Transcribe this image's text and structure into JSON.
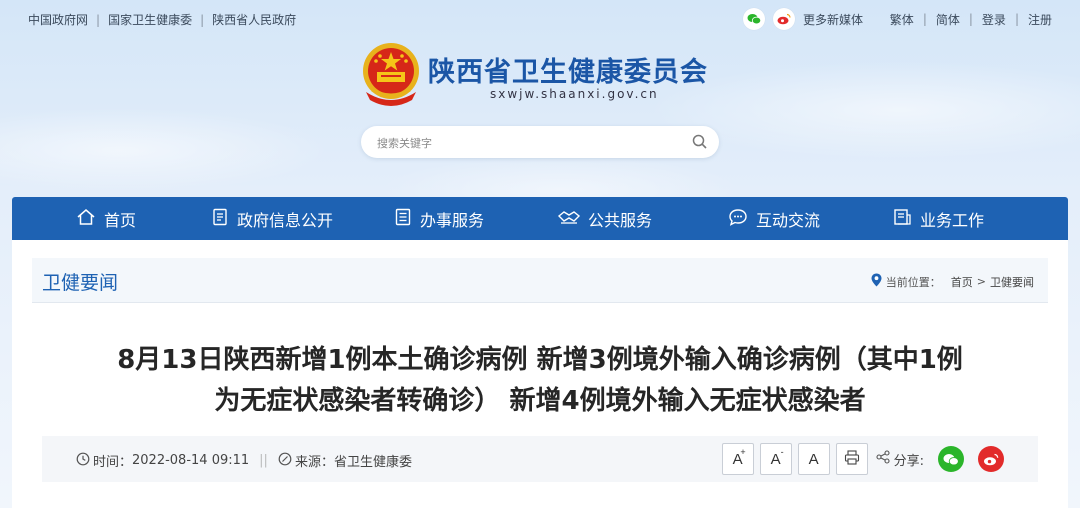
{
  "top_links": [
    "中国政府网",
    "国家卫生健康委",
    "陕西省人民政府"
  ],
  "top_right": {
    "media": "更多新媒体",
    "traditional": "繁体",
    "simplified": "简体",
    "login": "登录",
    "register": "注册"
  },
  "site": {
    "title": "陕西省卫生健康委员会",
    "domain": "sxwjw.shaanxi.gov.cn"
  },
  "search": {
    "placeholder": "搜索关键字"
  },
  "nav": {
    "items": [
      {
        "label": "首页",
        "icon": "home-icon"
      },
      {
        "label": "政府信息公开",
        "icon": "document-icon"
      },
      {
        "label": "办事服务",
        "icon": "service-icon"
      },
      {
        "label": "公共服务",
        "icon": "handshake-icon"
      },
      {
        "label": "互动交流",
        "icon": "chat-icon"
      },
      {
        "label": "业务工作",
        "icon": "briefcase-icon"
      }
    ]
  },
  "section": {
    "title": "卫健要闻",
    "breadcrumb_label": "当前位置：",
    "breadcrumb": [
      "首页",
      "卫健要闻"
    ]
  },
  "article": {
    "title_line1": "8月13日陕西新增1例本土确诊病例 新增3例境外输入确诊病例（其中1例",
    "title_line2": "为无症状感染者转确诊） 新增4例境外输入无症状感染者",
    "time_label": "时间：",
    "time": "2022-08-14 09:11",
    "source_label": "来源：",
    "source": "省卫生健康委",
    "font_large": "A",
    "font_small": "A",
    "font_default": "A",
    "share_label": "分享:"
  },
  "colors": {
    "nav": "#1e62b3",
    "title_blue": "#1b56a6",
    "wechat": "#2bb52b",
    "weibo": "#e22b2b"
  }
}
